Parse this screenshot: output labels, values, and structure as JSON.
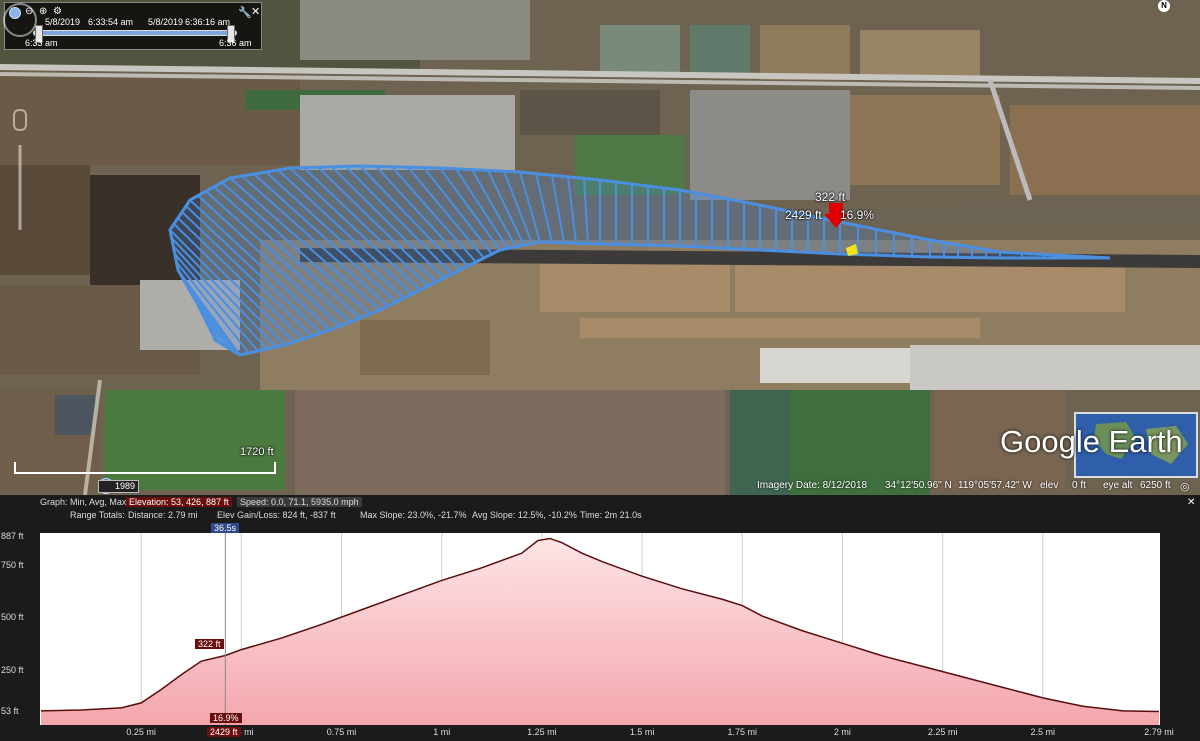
{
  "colors": {
    "track_blue": "#4a8fe0",
    "profile_fill": "#f4a6ad",
    "profile_line": "#5a0d0d",
    "marker_red": "#e00000"
  },
  "time_slider": {
    "start_date": "5/8/2019",
    "start_time": "6:33:54 am",
    "end_date": "5/8/2019",
    "end_time": "6:36:16 am",
    "range_start": "6:33 am",
    "range_end": "6:36 am",
    "icons": [
      "globe-icon",
      "zoom-out-icon",
      "zoom-in-icon",
      "settings-icon",
      "wrench-icon",
      "close-icon"
    ]
  },
  "map": {
    "marker_elevation": "322 ft",
    "marker_distance": "2429 ft",
    "marker_slope": "16.9%",
    "scale_label": "1720 ft",
    "historical_year": "1989",
    "compass_label": "N",
    "brand": "Google Earth",
    "status": {
      "imagery_date": "Imagery Date: 8/12/2018",
      "latitude": "34°12'50.96\" N",
      "longitude": "119°05'57.42\" W",
      "elev_label": "elev",
      "elev_value": "0 ft",
      "eye_alt_label": "eye alt",
      "eye_alt_value": "6250 ft"
    }
  },
  "profile": {
    "graph_label": "Graph: Min, Avg, Max",
    "elevation_stats": "Elevation: 53, 426, 887 ft",
    "speed_stats": "Speed: 0.0, 71.1, 5935.0 mph",
    "range_totals_label": "Range Totals:",
    "distance": "Distance: 2.79 mi",
    "elev_gain_loss": "Elev Gain/Loss: 824 ft, -837 ft",
    "max_slope": "Max Slope: 23.0%, -21.7%",
    "avg_slope": "Avg Slope: 12.5%, -10.2%",
    "time": "Time: 2m 21.0s",
    "cursor_time": "36.5s",
    "cursor_elevation": "322 ft",
    "cursor_slope": "16.9%",
    "cursor_distance": "2429 ft",
    "close_icon": "close-icon"
  },
  "chart_data": {
    "type": "area",
    "xlabel": "",
    "ylabel": "",
    "x_unit": "mi",
    "y_unit": "ft",
    "x_ticks": [
      "0.25 mi",
      "0.5 mi",
      "0.75 mi",
      "1 mi",
      "1.25 mi",
      "1.5 mi",
      "1.75 mi",
      "2 mi",
      "2.25 mi",
      "2.5 mi",
      "2.79 mi"
    ],
    "x_tick_values": [
      0.25,
      0.5,
      0.75,
      1,
      1.25,
      1.5,
      1.75,
      2,
      2.25,
      2.5
    ],
    "y_ticks": [
      "53 ft",
      "250 ft",
      "500 ft",
      "750 ft",
      "887 ft"
    ],
    "y_tick_values": [
      53,
      250,
      500,
      750,
      887
    ],
    "xlim": [
      0,
      2.79
    ],
    "ylim": [
      0,
      887
    ],
    "grid": true,
    "x": [
      0,
      0.1,
      0.2,
      0.25,
      0.3,
      0.35,
      0.4,
      0.46,
      0.5,
      0.6,
      0.7,
      0.8,
      0.9,
      1.0,
      1.1,
      1.2,
      1.24,
      1.27,
      1.3,
      1.35,
      1.4,
      1.5,
      1.6,
      1.7,
      1.75,
      1.8,
      1.9,
      2.0,
      2.1,
      2.2,
      2.3,
      2.4,
      2.5,
      2.6,
      2.7,
      2.79
    ],
    "y": [
      58,
      62,
      72,
      96,
      160,
      230,
      295,
      322,
      350,
      405,
      470,
      540,
      610,
      680,
      740,
      810,
      870,
      880,
      860,
      810,
      770,
      700,
      640,
      590,
      560,
      510,
      440,
      380,
      320,
      270,
      220,
      170,
      120,
      80,
      58,
      55
    ]
  }
}
